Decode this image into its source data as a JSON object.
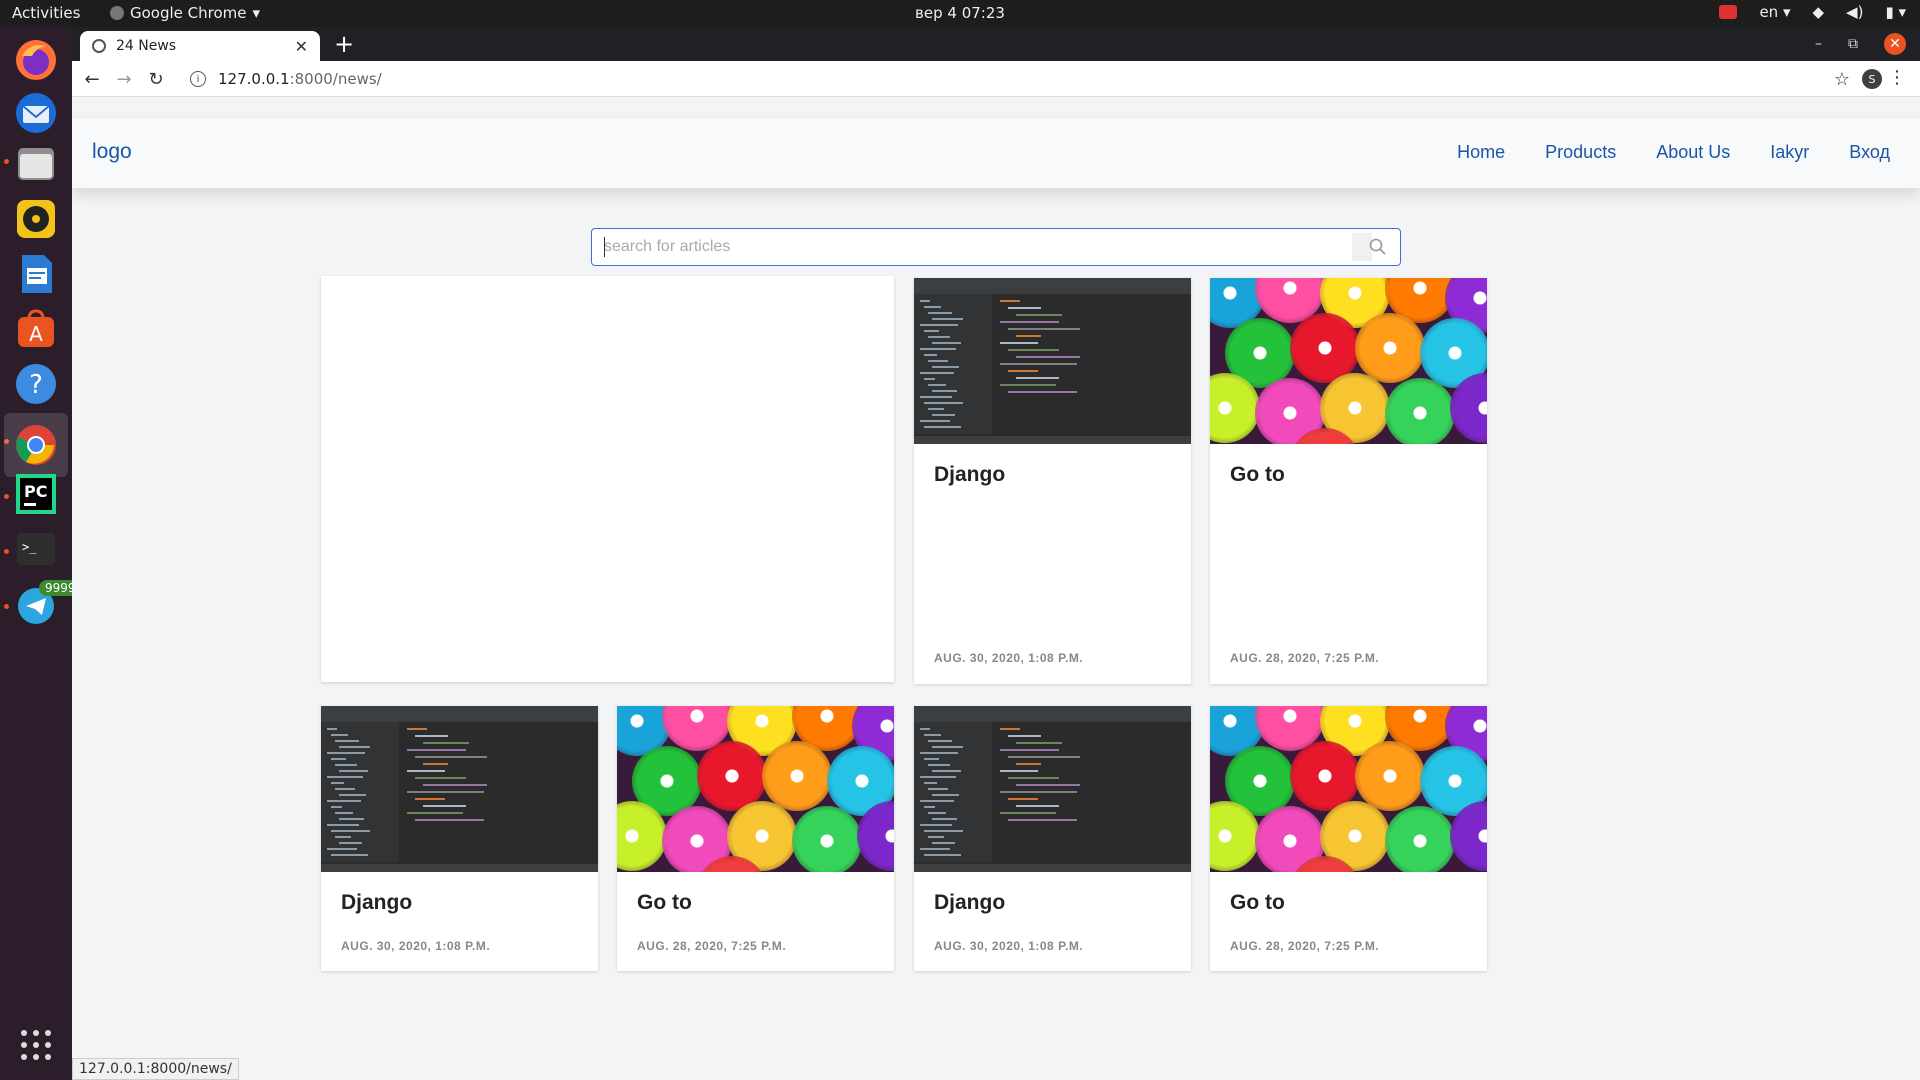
{
  "desktop": {
    "activities": "Activities",
    "app_menu": "Google Chrome",
    "clock": "вер 4  07:23",
    "lang": "en",
    "dock": [
      {
        "name": "firefox-icon"
      },
      {
        "name": "thunderbird-icon"
      },
      {
        "name": "files-icon"
      },
      {
        "name": "rhythmbox-icon"
      },
      {
        "name": "writer-icon"
      },
      {
        "name": "software-icon"
      },
      {
        "name": "help-icon"
      },
      {
        "name": "chrome-icon"
      },
      {
        "name": "pycharm-icon"
      },
      {
        "name": "terminal-icon"
      },
      {
        "name": "telegram-icon",
        "badge": "9999"
      }
    ]
  },
  "browser": {
    "tab_title": "24 News",
    "url_host": "127.0.0.1",
    "url_path": ":8000/news/",
    "status_url": "127.0.0.1:8000/news/",
    "profile_initial": "S"
  },
  "site": {
    "logo": "logo",
    "nav": [
      "Home",
      "Products",
      "About Us",
      "Iakyr",
      "Вход"
    ],
    "search_placeholder": "search for articles"
  },
  "articles": [
    {
      "title": "Django",
      "date": "AUG. 30, 2020, 1:08 P.M.",
      "image": "code-editor"
    },
    {
      "title": "Go to",
      "date": "AUG. 28, 2020, 7:25 P.M.",
      "image": "cupcakes"
    },
    {
      "title": "Django",
      "date": "AUG. 30, 2020, 1:08 P.M.",
      "image": "code-editor"
    },
    {
      "title": "Go to",
      "date": "AUG. 28, 2020, 7:25 P.M.",
      "image": "cupcakes"
    },
    {
      "title": "Django",
      "date": "AUG. 30, 2020, 1:08 P.M.",
      "image": "code-editor"
    },
    {
      "title": "Go to",
      "date": "AUG. 28, 2020, 7:25 P.M.",
      "image": "cupcakes"
    }
  ],
  "colors": {
    "link": "#1a56a8",
    "search_border": "#3b6fd6",
    "dock_bg": "#2b1e2a",
    "ubuntu_orange": "#e95420"
  }
}
